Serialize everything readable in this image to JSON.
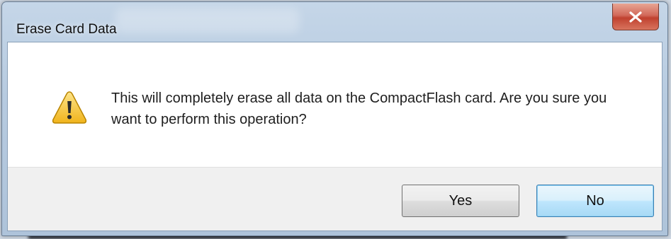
{
  "window": {
    "title": "Erase Card Data",
    "close_icon": "close-x-icon"
  },
  "message": {
    "icon": "warning-icon",
    "text": "This will completely erase all data on the CompactFlash card. Are you sure you want to perform this operation?"
  },
  "buttons": {
    "yes_label": "Yes",
    "no_label": "No"
  },
  "colors": {
    "close_button": "#c0412f",
    "default_button_border": "#3c7fb1",
    "warning_fill": "#f6c53a"
  }
}
